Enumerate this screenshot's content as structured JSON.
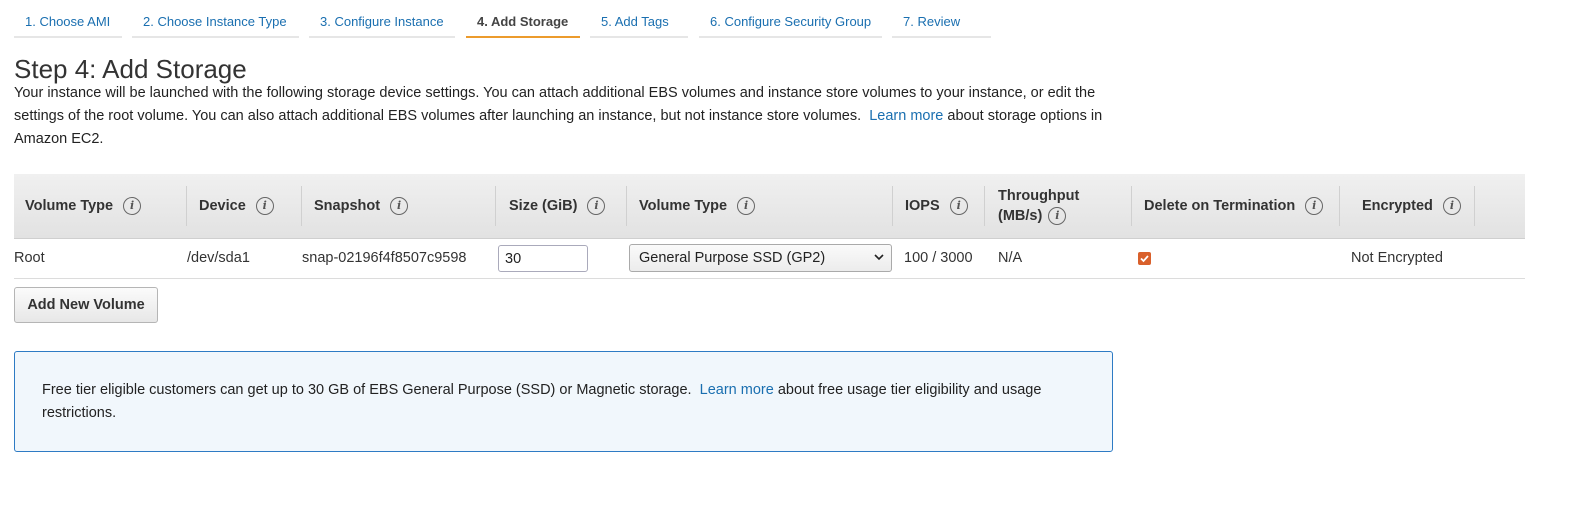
{
  "wizard": {
    "tabs": [
      {
        "label": "1. Choose AMI"
      },
      {
        "label": "2. Choose Instance Type"
      },
      {
        "label": "3. Configure Instance"
      },
      {
        "label": "4. Add Storage"
      },
      {
        "label": "5. Add Tags"
      },
      {
        "label": "6. Configure Security Group"
      },
      {
        "label": "7. Review"
      }
    ],
    "active_tab": "4. Add Storage",
    "accent_color": "#ec9b2c",
    "link_color": "#1a6fb0"
  },
  "page": {
    "title": "Step 4: Add Storage",
    "description_before_link": "Your instance will be launched with the following storage device settings. You can attach additional EBS volumes and instance store volumes to your instance, or edit the settings of the root volume. You can also attach additional EBS volumes after launching an instance, but not instance store volumes.",
    "learn_more": "Learn more",
    "description_after_link": "about storage options in Amazon EC2."
  },
  "table": {
    "columns": [
      {
        "label": "Volume Type"
      },
      {
        "label": "Device"
      },
      {
        "label": "Snapshot"
      },
      {
        "label": "Size (GiB)"
      },
      {
        "label": "Volume Type"
      },
      {
        "label": "IOPS"
      },
      {
        "label": "Throughput (MB/s)"
      },
      {
        "label": "Delete on Termination"
      },
      {
        "label": "Encrypted"
      }
    ],
    "info_icon": "info-icon",
    "rows": [
      {
        "volume_type": "Root",
        "device": "/dev/sda1",
        "snapshot": "snap-02196f4f8507c9598",
        "size": "30",
        "ebs_volume_type": "General Purpose SSD (GP2)",
        "iops": "100 / 3000",
        "throughput": "N/A",
        "delete_on_termination": true,
        "encrypted": "Not Encrypted"
      }
    ],
    "checkbox_color": "#d9602b"
  },
  "actions": {
    "add_new_volume": "Add New Volume"
  },
  "notice": {
    "text_before_link": "Free tier eligible customers can get up to 30 GB of EBS General Purpose (SSD) or Magnetic storage.",
    "learn_more": "Learn more",
    "text_after_link": "about free usage tier eligibility and usage restrictions.",
    "border_color": "#2e7bc4"
  }
}
